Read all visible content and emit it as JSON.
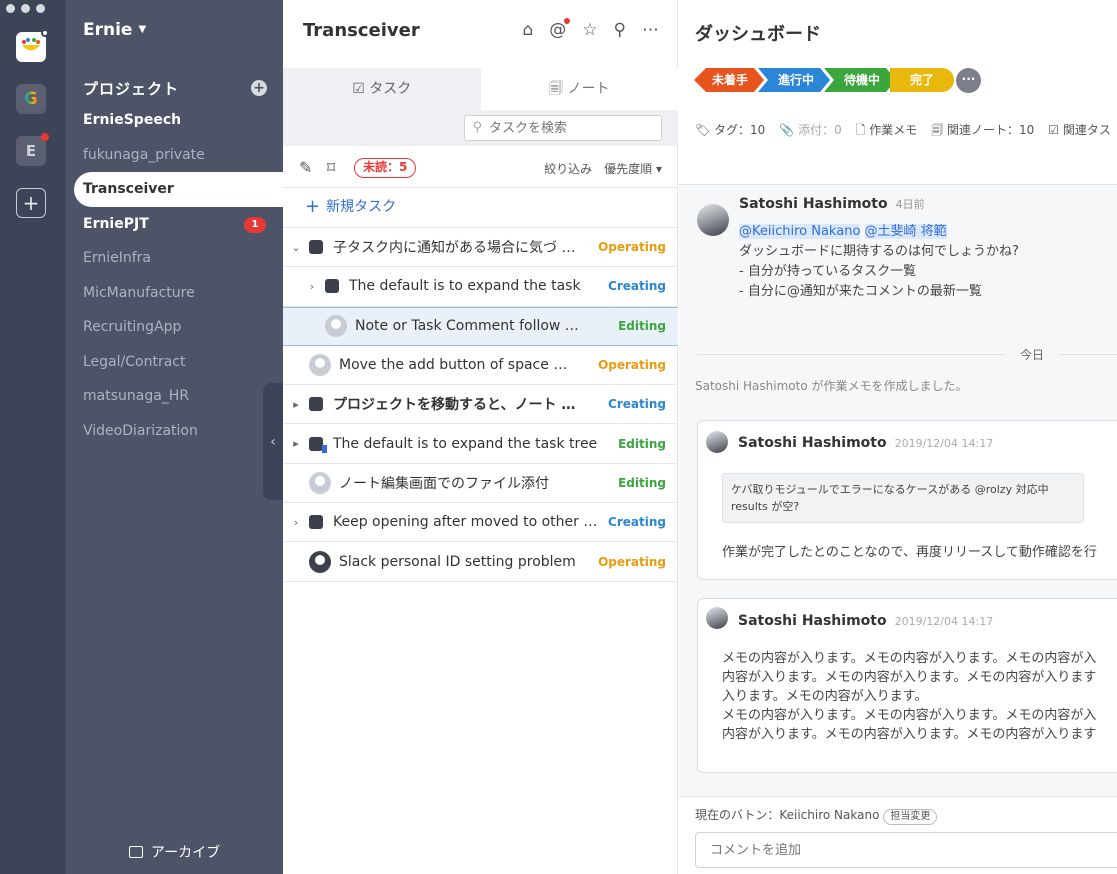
{
  "rail": {
    "workspaces": [
      {
        "letter": "G",
        "color": "#5a6072"
      },
      {
        "letter": "E",
        "color": "#5a6072"
      }
    ],
    "add_symbol": "+"
  },
  "sidebar": {
    "org_name": "Ernie",
    "projects_heading": "プロジェクト",
    "projects": [
      {
        "name": "ErnieSpeech",
        "bold": true
      },
      {
        "name": "fukunaga_private"
      },
      {
        "name": "Transceiver",
        "active": true
      },
      {
        "name": "ErniePJT",
        "bold": true,
        "badge": "1"
      },
      {
        "name": "ErnieInfra"
      },
      {
        "name": "MicManufacture"
      },
      {
        "name": "RecruitingApp"
      },
      {
        "name": "Legal/Contract"
      },
      {
        "name": "matsunaga_HR"
      },
      {
        "name": "VideoDiarization"
      }
    ],
    "archive_label": "アーカイブ"
  },
  "middle": {
    "title": "Transceiver",
    "tabs": [
      {
        "label": "☑ タスク",
        "active": true
      },
      {
        "label": "🗐 ノート",
        "active": false
      }
    ],
    "search_placeholder": "タスクを検索",
    "unread_label": "未読：5",
    "filter_label": "絞り込み　優先度順 ▾",
    "new_task_label": "新規タスク",
    "tasks": [
      {
        "name": "子タスク内に通知がある場合に気づ …",
        "status": "Operating",
        "kind": "task",
        "chevron": "⌄",
        "indent": 0
      },
      {
        "name": "The default is to expand the task",
        "status": "Creating",
        "kind": "task",
        "chevron": "›",
        "indent": 1
      },
      {
        "name": "Note or Task Comment follow …",
        "status": "Editing",
        "kind": "user",
        "chevron": "",
        "indent": 1,
        "selected": true
      },
      {
        "name": "Move the add button of space …",
        "status": "Operating",
        "kind": "user",
        "chevron": "",
        "indent": 0
      },
      {
        "name": "プロジェクトを移動すると、ノート …",
        "status": "Creating",
        "kind": "task",
        "chevron": "▸",
        "indent": 0,
        "bold": true
      },
      {
        "name": "The default is to expand the task tree",
        "status": "Editing",
        "kind": "task-flag",
        "chevron": "▸",
        "indent": 0,
        "red": true
      },
      {
        "name": "ノート編集画面でのファイル添付",
        "status": "Editing",
        "kind": "user",
        "chevron": "",
        "indent": 0
      },
      {
        "name": "Keep opening after moved to other …",
        "status": "Creating",
        "kind": "task",
        "chevron": "›",
        "indent": 0
      },
      {
        "name": "Slack personal ID setting problem",
        "status": "Operating",
        "kind": "slack",
        "chevron": "",
        "indent": 0
      }
    ]
  },
  "right": {
    "title": "ダッシュボード",
    "pipeline": [
      {
        "label": "未着手",
        "color": "#e8541e"
      },
      {
        "label": "進行中",
        "color": "#2a86d6"
      },
      {
        "label": "待機中",
        "color": "#3aa63d"
      },
      {
        "label": "完了",
        "color": "#e8b80c"
      }
    ],
    "more_symbol": "···",
    "meta": {
      "tags": "🏷 タグ：10",
      "attach": "📎 添付：0",
      "work_memo": "🗋 作業メモ",
      "related_notes": "🗐 関連ノート：10",
      "related_tasks": "☑ 関連タス"
    },
    "comment1": {
      "author": "Satoshi Hashimoto",
      "time": "4日前",
      "mention1": "@Keiichiro Nakano",
      "mention2": "@土斐崎 将範",
      "line1": "ダッシュボードに期待するのは何でしょうかね?",
      "line2": "- 自分が持っているタスク一覧",
      "line3": "- 自分に@通知が来たコメントの最新一覧"
    },
    "divider_label": "今日",
    "system_message": "Satoshi Hashimoto が作業メモを作成しました。",
    "card1": {
      "author": "Satoshi Hashimoto",
      "time": "2019/12/04 14:17",
      "quote_line1": "ケバ取りモジュールでエラーになるケースがある @rolzy 対応中",
      "quote_line2": "results が空?",
      "text": "作業が完了したとのことなので、再度リリースして動作確認を行"
    },
    "card2": {
      "author": "Satoshi Hashimoto",
      "time": "2019/12/04 14:17",
      "lines": [
        "メモの内容が入ります。メモの内容が入ります。メモの内容が入",
        "内容が入ります。メモの内容が入ります。メモの内容が入ります",
        "入ります。メモの内容が入ります。",
        "メモの内容が入ります。メモの内容が入ります。メモの内容が入",
        "内容が入ります。メモの内容が入ります。メモの内容が入ります"
      ]
    },
    "composer": {
      "baton_text": "現在のバトン：Keiichiro Nakano",
      "change_label": "担当変更",
      "placeholder": "コメントを追加"
    }
  }
}
